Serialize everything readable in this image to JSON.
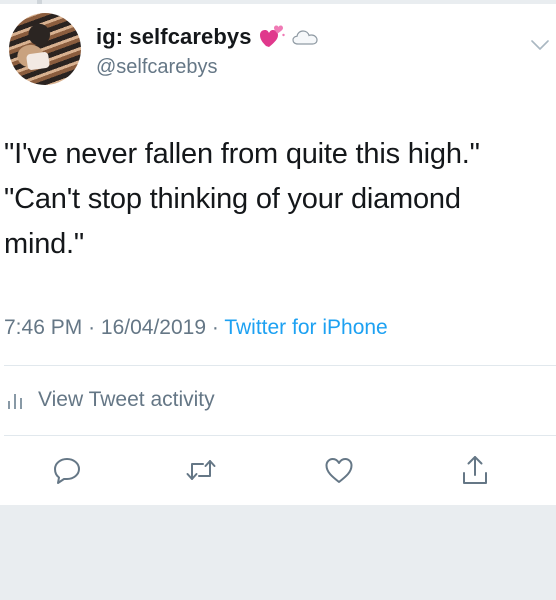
{
  "tweet": {
    "display_name": "ig: selfcarebys",
    "handle": "@selfcarebys",
    "text_lines": [
      "\"I've never fallen from quite this high.\"",
      "\"Can't stop thinking of your diamond",
      "mind.\""
    ],
    "time": "7:46 PM",
    "date": "16/04/2019",
    "source": "Twitter for iPhone",
    "separator": "·"
  },
  "activity": {
    "label": "View Tweet activity"
  },
  "icons": {
    "avatar": "profile-photo",
    "name_emoji_1": "two-hearts-icon",
    "name_emoji_2": "cloud-icon",
    "menu": "chevron-down-icon",
    "activity": "bar-chart-icon",
    "actions": [
      "reply-icon",
      "retweet-icon",
      "like-icon",
      "share-icon"
    ]
  },
  "colors": {
    "text": "#14171a",
    "secondary": "#657786",
    "link": "#1da1f2",
    "heart": "#e0388c",
    "divider": "#e1e8ed",
    "background_bar": "#e9edf0"
  }
}
